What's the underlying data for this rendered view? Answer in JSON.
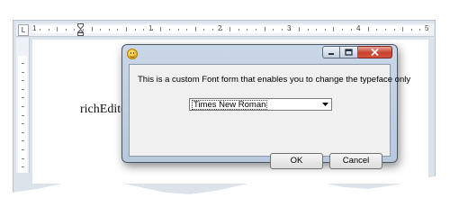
{
  "ruler": {
    "corner_glyph": "L",
    "numbers": [
      "1",
      "1",
      "2",
      "3",
      "4",
      "5"
    ]
  },
  "document": {
    "text": "richEdit("
  },
  "dialog": {
    "message": "This is a custom Font form that enables you to change the typeface only",
    "font_select": {
      "value": "Times New Roman"
    },
    "ok_label": "OK",
    "cancel_label": "Cancel"
  },
  "icons": {
    "app": "smiley-icon",
    "minimize": "minimize-icon",
    "maximize": "maximize-icon",
    "close": "close-icon",
    "dropdown": "chevron-down-icon",
    "indent": "indent-marker-icon"
  },
  "colors": {
    "dialog_frame": "#b8c9de",
    "close_button": "#c8402c",
    "client_bg": "#f0f0f0"
  }
}
